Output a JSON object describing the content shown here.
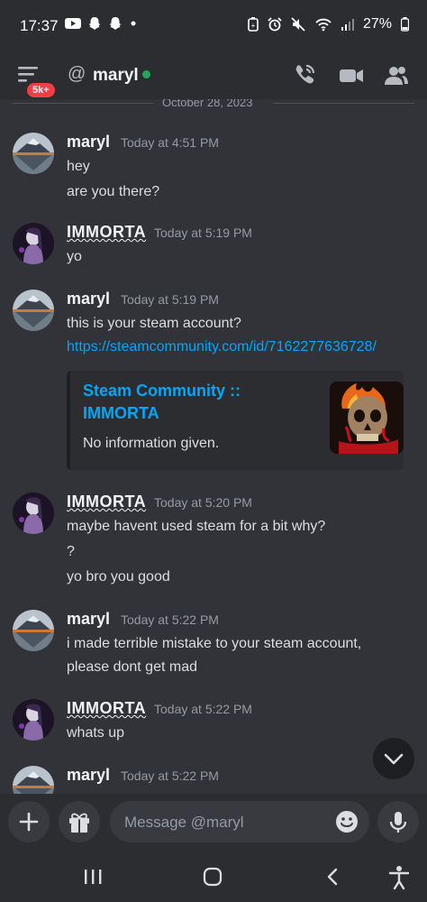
{
  "status_bar": {
    "time": "17:37",
    "battery": "27%",
    "icons": [
      "youtube-icon",
      "snapchat-icon",
      "snapchat-icon",
      "dot-icon",
      "battery-saver-icon",
      "alarm-icon",
      "mute-icon",
      "wifi-icon",
      "signal-icon",
      "battery-icon"
    ]
  },
  "header": {
    "badge": "5k+",
    "at_symbol": "@",
    "dm_name": "maryl",
    "online_color": "#23a55a"
  },
  "divider": {
    "date": "October 28, 2023"
  },
  "messages": [
    {
      "author": "maryl",
      "time": "Today at 4:51 PM",
      "lines": [
        "hey",
        "are you there?"
      ]
    },
    {
      "author": "IMMORTA",
      "time": "Today at 5:19 PM",
      "lines": [
        "yo"
      ]
    },
    {
      "author": "maryl",
      "time": "Today at 5:19 PM",
      "lines": [
        "this is your steam account?",
        "https://steamcommunity.com/id/7162277636728/"
      ],
      "embed": {
        "title": "Steam Community :: IMMORTA",
        "description": "No information given."
      }
    },
    {
      "author": "IMMORTA",
      "time": "Today at 5:20 PM",
      "lines": [
        "maybe havent used steam for a bit why?",
        "?",
        "yo bro you good"
      ]
    },
    {
      "author": "maryl",
      "time": "Today at 5:22 PM",
      "lines": [
        "i made terrible mistake to your steam account,",
        "please dont get mad"
      ]
    },
    {
      "author": "IMMORTA",
      "time": "Today at 5:22 PM",
      "lines": [
        "whats up"
      ]
    },
    {
      "author": "maryl",
      "time": "Today at 5:22 PM",
      "lines": []
    }
  ],
  "composer": {
    "placeholder": "Message @maryl"
  },
  "colors": {
    "background": "#313338",
    "link": "#00a8fc",
    "badge": "#f23f43"
  }
}
